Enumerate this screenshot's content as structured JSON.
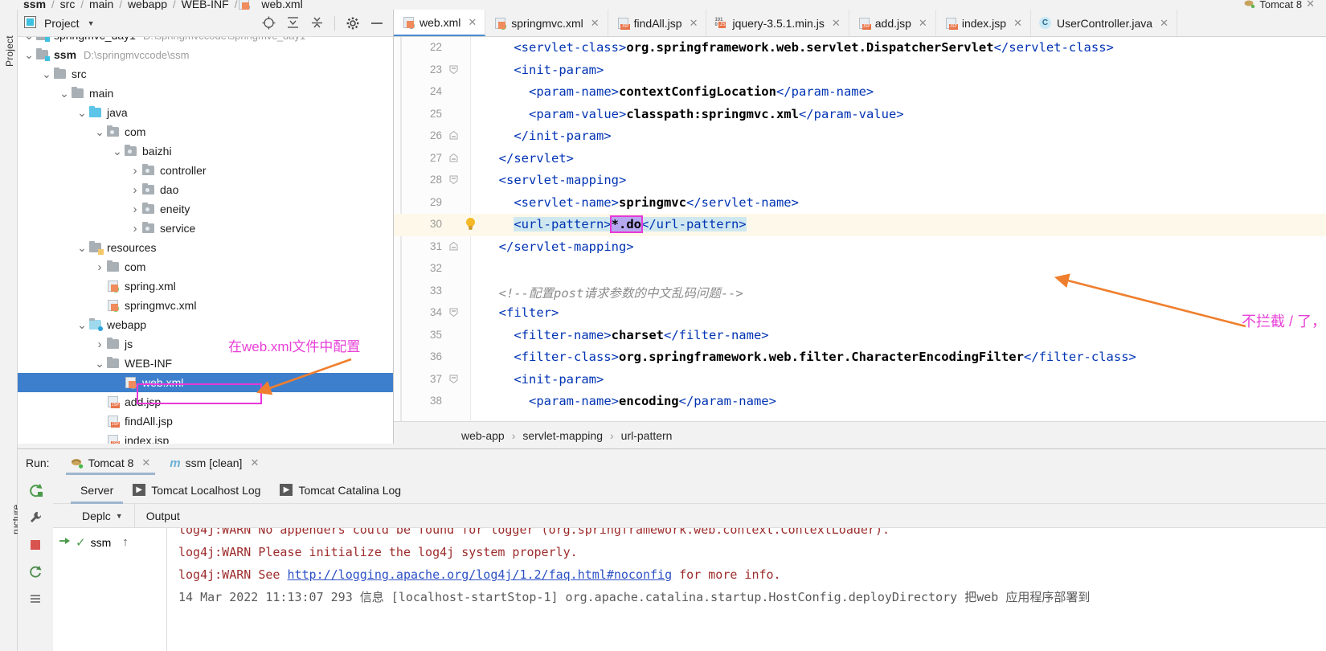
{
  "window": {
    "top_breadcrumb": [
      "ssm",
      "src",
      "main",
      "webapp",
      "WEB-INF",
      "web.xml"
    ],
    "top_right_run_config": "Tomcat 8"
  },
  "project_panel": {
    "title": "Project",
    "toolbar_icons": [
      "locate-icon",
      "expand-all-icon",
      "collapse-all-icon",
      "settings-gear-icon",
      "hide-icon"
    ],
    "vertical_label": "Project",
    "tree": [
      {
        "label": "springmvc_day1",
        "path": "D:\\springmvccode\\springmvc_day1",
        "depth": 0,
        "arrow": "down",
        "icon": "module-folder-icon",
        "clipped": true
      },
      {
        "label": "ssm",
        "path": "D:\\springmvccode\\ssm",
        "depth": 0,
        "arrow": "down",
        "icon": "module-folder-icon",
        "bold": true
      },
      {
        "label": "src",
        "path": "",
        "depth": 1,
        "arrow": "down",
        "icon": "folder-icon"
      },
      {
        "label": "main",
        "path": "",
        "depth": 2,
        "arrow": "down",
        "icon": "folder-icon"
      },
      {
        "label": "java",
        "path": "",
        "depth": 3,
        "arrow": "down",
        "icon": "source-folder-icon"
      },
      {
        "label": "com",
        "path": "",
        "depth": 4,
        "arrow": "down",
        "icon": "package-icon"
      },
      {
        "label": "baizhi",
        "path": "",
        "depth": 5,
        "arrow": "down",
        "icon": "package-icon"
      },
      {
        "label": "controller",
        "path": "",
        "depth": 6,
        "arrow": "right",
        "icon": "package-icon"
      },
      {
        "label": "dao",
        "path": "",
        "depth": 6,
        "arrow": "right",
        "icon": "package-icon"
      },
      {
        "label": "eneity",
        "path": "",
        "depth": 6,
        "arrow": "right",
        "icon": "package-icon"
      },
      {
        "label": "service",
        "path": "",
        "depth": 6,
        "arrow": "right",
        "icon": "package-icon"
      },
      {
        "label": "resources",
        "path": "",
        "depth": 3,
        "arrow": "down",
        "icon": "resource-folder-icon"
      },
      {
        "label": "com",
        "path": "",
        "depth": 4,
        "arrow": "right",
        "icon": "folder-icon"
      },
      {
        "label": "spring.xml",
        "path": "",
        "depth": 4,
        "arrow": "none",
        "icon": "spring-xml-icon"
      },
      {
        "label": "springmvc.xml",
        "path": "",
        "depth": 4,
        "arrow": "none",
        "icon": "spring-xml-icon"
      },
      {
        "label": "webapp",
        "path": "",
        "depth": 3,
        "arrow": "down",
        "icon": "web-folder-icon"
      },
      {
        "label": "js",
        "path": "",
        "depth": 4,
        "arrow": "right",
        "icon": "folder-icon"
      },
      {
        "label": "WEB-INF",
        "path": "",
        "depth": 4,
        "arrow": "down",
        "icon": "folder-icon"
      },
      {
        "label": "web.xml",
        "path": "",
        "depth": 5,
        "arrow": "none",
        "icon": "web-xml-icon",
        "selected": true
      },
      {
        "label": "add.jsp",
        "path": "",
        "depth": 4,
        "arrow": "none",
        "icon": "jsp-icon"
      },
      {
        "label": "findAll.jsp",
        "path": "",
        "depth": 4,
        "arrow": "none",
        "icon": "jsp-icon"
      },
      {
        "label": "index.jsp",
        "path": "",
        "depth": 4,
        "arrow": "none",
        "icon": "jsp-icon",
        "clipped": true
      }
    ],
    "annotation": "在web.xml文件中配置",
    "annotation_color": "#e83fd8",
    "arrow_color": "#ef7f2e"
  },
  "editor": {
    "tabs": [
      {
        "label": "web.xml",
        "icon": "xml-file-icon",
        "active": true
      },
      {
        "label": "springmvc.xml",
        "icon": "spring-xml-icon",
        "active": false
      },
      {
        "label": "findAll.jsp",
        "icon": "jsp-icon",
        "active": false
      },
      {
        "label": "jquery-3.5.1.min.js",
        "icon": "js-file-icon",
        "active": false
      },
      {
        "label": "add.jsp",
        "icon": "jsp-icon",
        "active": false
      },
      {
        "label": "index.jsp",
        "icon": "jsp-icon",
        "active": false
      },
      {
        "label": "UserController.java",
        "icon": "java-class-icon",
        "active": false
      }
    ],
    "lines": [
      {
        "num": "22",
        "fold": "",
        "segments": [
          {
            "t": "    ",
            "c": "txt"
          },
          {
            "t": "<servlet-class>",
            "c": "tag"
          },
          {
            "t": "org.springframework.web.servlet.DispatcherServlet",
            "c": "txt"
          },
          {
            "t": "</servlet-class>",
            "c": "tag"
          }
        ]
      },
      {
        "num": "23",
        "fold": "minus-open",
        "segments": [
          {
            "t": "    ",
            "c": "txt"
          },
          {
            "t": "<init-param>",
            "c": "tag"
          }
        ]
      },
      {
        "num": "24",
        "fold": "",
        "segments": [
          {
            "t": "      ",
            "c": "txt"
          },
          {
            "t": "<param-name>",
            "c": "tag"
          },
          {
            "t": "contextConfigLocation",
            "c": "txt"
          },
          {
            "t": "</param-name>",
            "c": "tag"
          }
        ]
      },
      {
        "num": "25",
        "fold": "",
        "segments": [
          {
            "t": "      ",
            "c": "txt"
          },
          {
            "t": "<param-value>",
            "c": "tag"
          },
          {
            "t": "classpath:springmvc.xml",
            "c": "txt"
          },
          {
            "t": "</param-value>",
            "c": "tag"
          }
        ]
      },
      {
        "num": "26",
        "fold": "minus-close",
        "segments": [
          {
            "t": "    ",
            "c": "txt"
          },
          {
            "t": "</init-param>",
            "c": "tag"
          }
        ]
      },
      {
        "num": "27",
        "fold": "minus-close",
        "segments": [
          {
            "t": "  ",
            "c": "txt"
          },
          {
            "t": "</servlet>",
            "c": "tag"
          }
        ]
      },
      {
        "num": "28",
        "fold": "minus-open",
        "segments": [
          {
            "t": "  ",
            "c": "txt"
          },
          {
            "t": "<servlet-mapping>",
            "c": "tag"
          }
        ]
      },
      {
        "num": "29",
        "fold": "",
        "segments": [
          {
            "t": "    ",
            "c": "txt"
          },
          {
            "t": "<servlet-name>",
            "c": "tag"
          },
          {
            "t": "springmvc",
            "c": "txt"
          },
          {
            "t": "</servlet-name>",
            "c": "tag"
          }
        ]
      },
      {
        "num": "30",
        "fold": "",
        "bulb": true,
        "highlight": true,
        "segments": [
          {
            "t": "    ",
            "c": "txt"
          },
          {
            "t": "<url-pattern>",
            "c": "tag hl-sel"
          },
          {
            "t": "*.do",
            "c": "txt boxsel"
          },
          {
            "t": "</url-pattern>",
            "c": "tag hl-sel"
          }
        ]
      },
      {
        "num": "31",
        "fold": "minus-close",
        "segments": [
          {
            "t": "  ",
            "c": "txt"
          },
          {
            "t": "</servlet-mapping>",
            "c": "tag"
          }
        ]
      },
      {
        "num": "32",
        "fold": "",
        "segments": [
          {
            "t": "",
            "c": "txt"
          }
        ]
      },
      {
        "num": "33",
        "fold": "",
        "segments": [
          {
            "t": "  ",
            "c": "txt"
          },
          {
            "t": "<!--配置post请求参数的中文乱码问题-->",
            "c": "cmt"
          }
        ]
      },
      {
        "num": "34",
        "fold": "minus-open",
        "segments": [
          {
            "t": "  ",
            "c": "txt"
          },
          {
            "t": "<filter>",
            "c": "tag"
          }
        ]
      },
      {
        "num": "35",
        "fold": "",
        "segments": [
          {
            "t": "    ",
            "c": "txt"
          },
          {
            "t": "<filter-name>",
            "c": "tag"
          },
          {
            "t": "charset",
            "c": "txt"
          },
          {
            "t": "</filter-name>",
            "c": "tag"
          }
        ]
      },
      {
        "num": "36",
        "fold": "",
        "segments": [
          {
            "t": "    ",
            "c": "txt"
          },
          {
            "t": "<filter-class>",
            "c": "tag"
          },
          {
            "t": "org.springframework.web.filter.CharacterEncodingFilter",
            "c": "txt"
          },
          {
            "t": "</filter-class>",
            "c": "tag"
          }
        ]
      },
      {
        "num": "37",
        "fold": "minus-open",
        "segments": [
          {
            "t": "    ",
            "c": "txt"
          },
          {
            "t": "<init-param>",
            "c": "tag"
          }
        ]
      },
      {
        "num": "38",
        "fold": "",
        "segments": [
          {
            "t": "      ",
            "c": "txt"
          },
          {
            "t": "<param-name>",
            "c": "tag"
          },
          {
            "t": "encoding",
            "c": "txt"
          },
          {
            "t": "</param-name>",
            "c": "tag"
          }
        ]
      }
    ],
    "breadcrumb": [
      "web-app",
      "servlet-mapping",
      "url-pattern"
    ],
    "annotation": "不拦截 / 了，拦截以 .do 结尾的",
    "annotation_color": "#e83fd8"
  },
  "run_panel": {
    "run_label": "Run:",
    "tabs": [
      {
        "label": "Tomcat 8",
        "icon": "tomcat-icon",
        "active": true
      },
      {
        "label": "ssm [clean]",
        "icon": "maven-icon",
        "active": false
      }
    ],
    "log_tabs": [
      {
        "label": "Server",
        "icon": "",
        "active": true
      },
      {
        "label": "Tomcat Localhost Log",
        "icon": "arrow-box-icon",
        "active": false
      },
      {
        "label": "Tomcat Catalina Log",
        "icon": "arrow-box-icon",
        "active": false
      }
    ],
    "sub_tabs": [
      {
        "label": "Deplc",
        "icon": "chevron-down-icon"
      },
      {
        "label": "Output",
        "icon": ""
      }
    ],
    "deploy_item": "ssm",
    "rail_icons": [
      "rerun-icon",
      "wrench-icon",
      "stop-icon",
      "restart-icon",
      "scroll-icon"
    ],
    "console_lines": [
      {
        "text": "log4j:WARN No appenders could be found for logger (org.springframework.web.context.ContextLoader).",
        "clipped_top": true
      },
      {
        "text": "log4j:WARN Please initialize the log4j system properly."
      },
      {
        "text": "log4j:WARN See ",
        "link": "http://logging.apache.org/log4j/1.2/faq.html#noconfig",
        "tail": " for more info."
      },
      {
        "text": "14 Mar 2022 11:13:07 293 信息 [localhost-startStop-1] org.apache.catalina.startup.HostConfig.deployDirectory 把web 应用程序部署到",
        "clipped_bottom": true
      }
    ]
  }
}
